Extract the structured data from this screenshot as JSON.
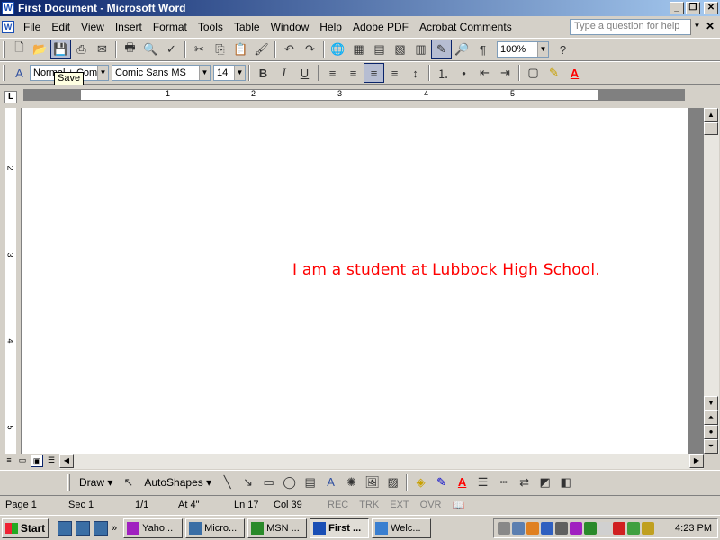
{
  "window": {
    "title": "First Document - Microsoft Word"
  },
  "menu": {
    "items": [
      "File",
      "Edit",
      "View",
      "Insert",
      "Format",
      "Tools",
      "Table",
      "Window",
      "Help",
      "Adobe PDF",
      "Acrobat Comments"
    ],
    "ask_placeholder": "Type a question for help"
  },
  "standard_toolbar": {
    "zoom": "100%"
  },
  "formatting_toolbar": {
    "style": "Normal + Comic",
    "font": "Comic Sans MS",
    "size": "14",
    "tooltip": "Save"
  },
  "ruler": {
    "h_numbers": [
      "1",
      "2",
      "3",
      "4",
      "5"
    ],
    "v_numbers": [
      "2",
      "3",
      "4",
      "5"
    ]
  },
  "document": {
    "text": "I am a student at Lubbock High School.",
    "text_color": "#ff0000"
  },
  "drawing_toolbar": {
    "draw": "Draw ▾",
    "autoshapes": "AutoShapes ▾"
  },
  "status": {
    "page": "Page 1",
    "sec": "Sec 1",
    "pages": "1/1",
    "at": "At 4\"",
    "ln": "Ln 17",
    "col": "Col 39",
    "rec": "REC",
    "trk": "TRK",
    "ext": "EXT",
    "ovr": "OVR"
  },
  "taskbar": {
    "start": "Start",
    "tasks": [
      "Yaho...",
      "Micro...",
      "MSN ...",
      "First ...",
      "Welc..."
    ],
    "clock": "4:23 PM"
  }
}
